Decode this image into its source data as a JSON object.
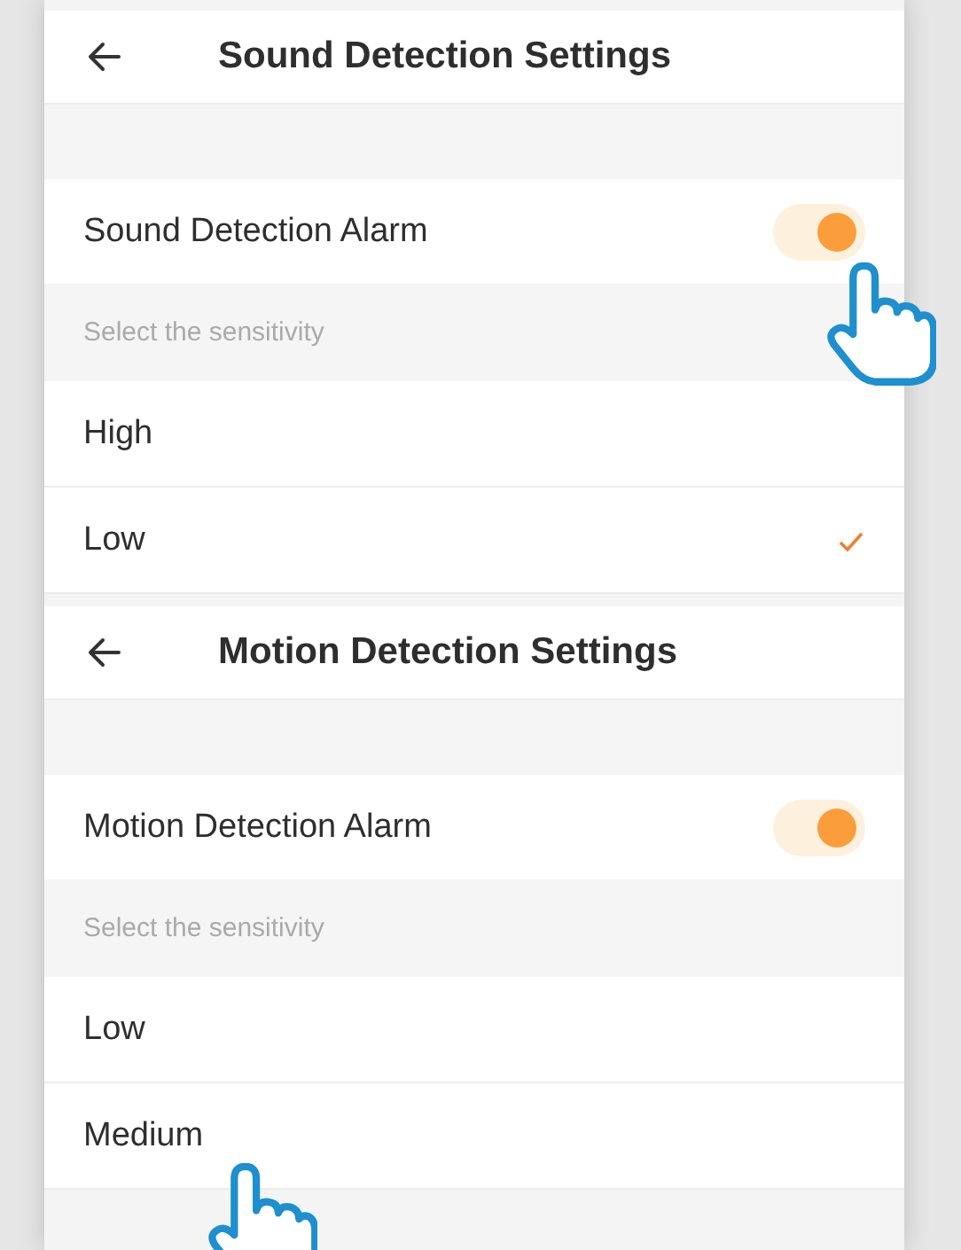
{
  "screens": [
    {
      "title": "Sound Detection Settings",
      "alarm": {
        "label": "Sound Detection Alarm",
        "on": true,
        "tapped": true
      },
      "section_label": "Select the sensitivity",
      "options": [
        {
          "label": "High",
          "selected": false,
          "tapped": false
        },
        {
          "label": "Low",
          "selected": true,
          "tapped": false
        }
      ]
    },
    {
      "title": "Motion Detection Settings",
      "alarm": {
        "label": "Motion Detection Alarm",
        "on": true,
        "tapped": false
      },
      "section_label": "Select the sensitivity",
      "options": [
        {
          "label": "Low",
          "selected": false,
          "tapped": false
        },
        {
          "label": "Medium",
          "selected": false,
          "tapped": true
        }
      ]
    }
  ]
}
